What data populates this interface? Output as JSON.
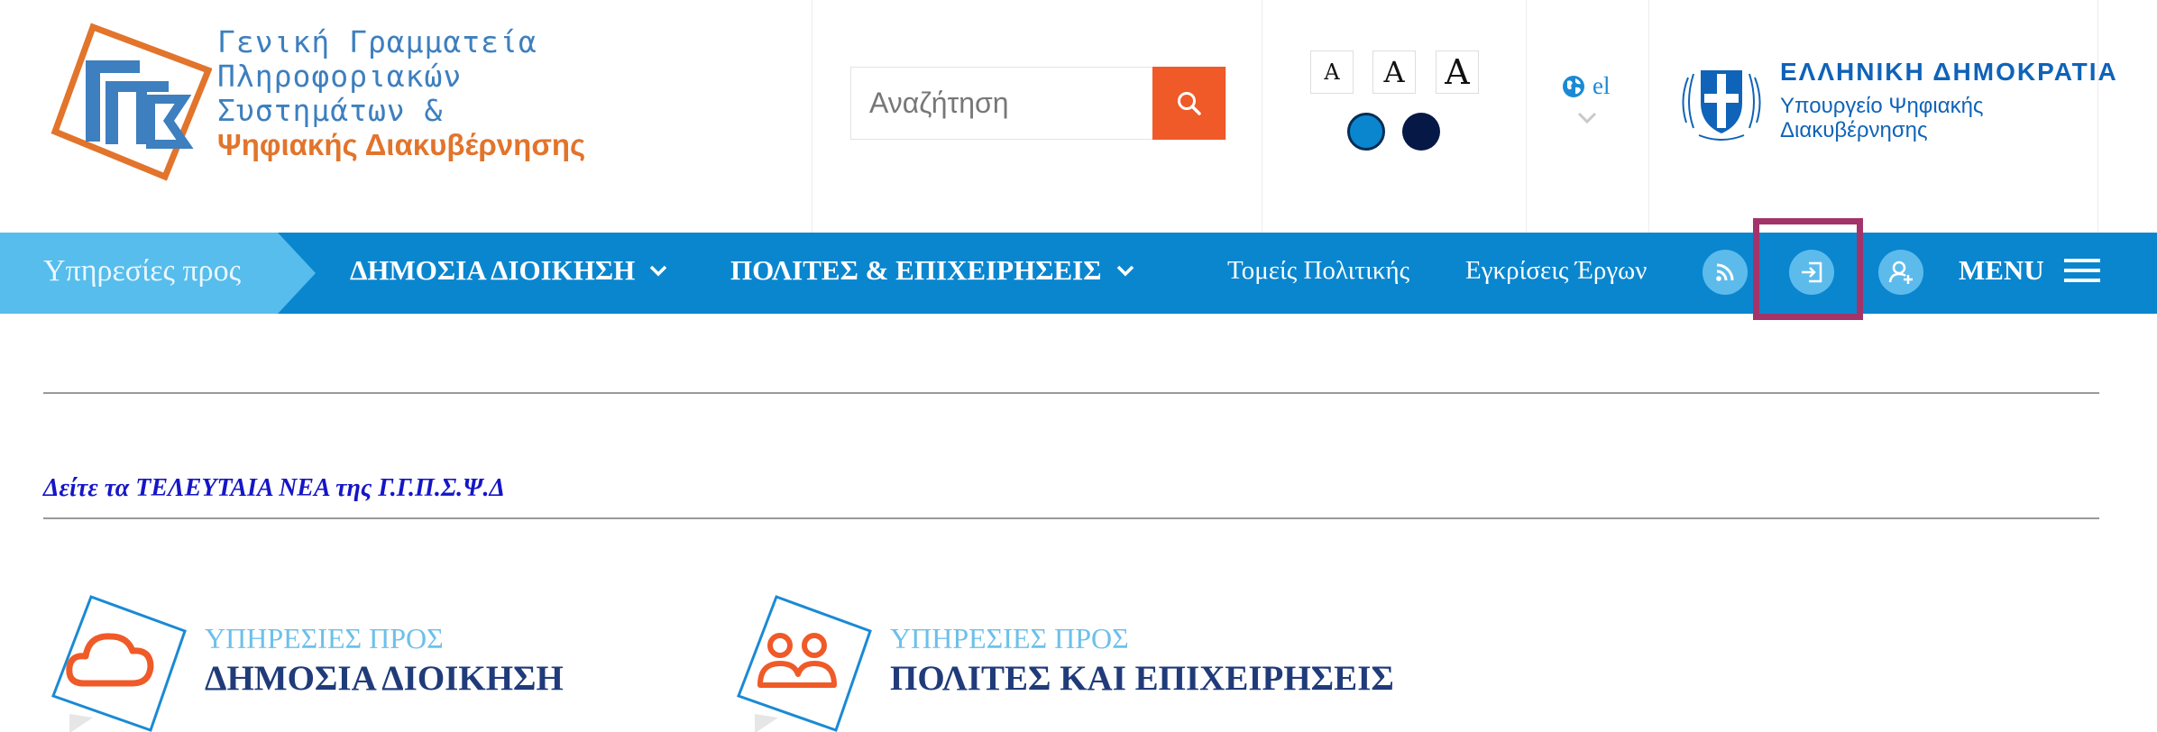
{
  "header": {
    "logo": {
      "line1": "Γενική Γραμματεία",
      "line2": "Πληροφοριακών",
      "line3": "Συστημάτων &",
      "line4": "Ψηφιακής Διακυβέρνησης"
    },
    "search": {
      "placeholder": "Αναζήτηση"
    },
    "font_sizes": [
      "A",
      "A",
      "A"
    ],
    "contrast_colors": [
      "#0a86cf",
      "#061845"
    ],
    "language": "el",
    "gov": {
      "title": "ΕΛΛΗΝΙΚΗ ΔΗΜΟΚΡΑΤΙΑ",
      "ministry_line1": "Υπουργείο Ψηφιακής",
      "ministry_line2": "Διακυβέρνησης"
    }
  },
  "nav": {
    "intro": "Υπηρεσίες προς",
    "public_admin": "ΔΗΜΟΣΙΑ ΔΙΟΙΚΗΣΗ",
    "citizens": "ΠΟΛΙΤΕΣ & ΕΠΙΧΕΙΡΗΣΕΙΣ",
    "policy": "Τομείς Πολιτικής",
    "approvals": "Εγκρίσεις Έργων",
    "menu": "MENU",
    "icons": [
      "rss-icon",
      "login-icon",
      "register-user-icon",
      "hamburger-icon"
    ],
    "highlight_color": "#a33469"
  },
  "main": {
    "latest_news": "Δείτε τα ΤΕΛΕΥΤΑΙΑ ΝΕΑ της Γ.Γ.Π.Σ.Ψ.Δ",
    "cards": [
      {
        "pre": "ΥΠΗΡΕΣΙΕΣ ΠΡΟΣ",
        "title": "ΔΗΜΟΣΙΑ ΔΙΟΙΚΗΣΗ",
        "icon": "cloud-icon"
      },
      {
        "pre": "ΥΠΗΡΕΣΙΕΣ ΠΡΟΣ",
        "title": "ΠΟΛΙΤΕΣ ΚΑΙ ΕΠΙΧΕΙΡΗΣΕΙΣ",
        "icon": "people-icon"
      }
    ]
  },
  "colors": {
    "nav_blue": "#0a86cf",
    "nav_light": "#56bdec",
    "search_orange": "#ef5a28",
    "logo_blue": "#3d7fbf",
    "logo_orange": "#e2742b",
    "title_navy": "#203b7a",
    "link_blue": "#1515c8"
  }
}
